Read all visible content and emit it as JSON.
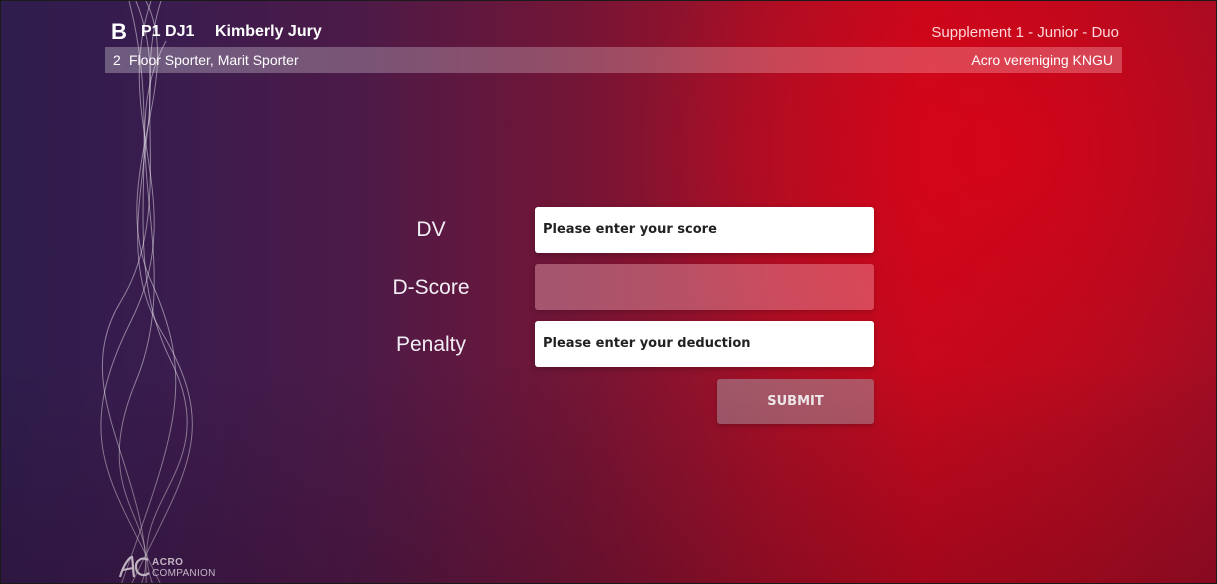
{
  "header": {
    "group_letter": "B",
    "panel_code": "P1 DJ1",
    "jury_name": "Kimberly Jury",
    "category": "Supplement 1 - Junior - Duo"
  },
  "performance": {
    "start_number": "2",
    "athletes": "Floor Sporter, Marit Sporter",
    "club": "Acro vereniging KNGU"
  },
  "form": {
    "dv_label": "DV",
    "dv_placeholder": "Please enter your score",
    "dscore_label": "D-Score",
    "dscore_value": "",
    "penalty_label": "Penalty",
    "penalty_placeholder": "Please enter your deduction",
    "submit_label": "SUBMIT"
  },
  "logo": {
    "line1": "ACRO",
    "line2": "COMPANION"
  },
  "colors": {
    "background_left": "#2e1d4d",
    "background_right": "#c4091d",
    "input_bg": "#ffffff",
    "submit_bg": "#9a7f8a"
  }
}
